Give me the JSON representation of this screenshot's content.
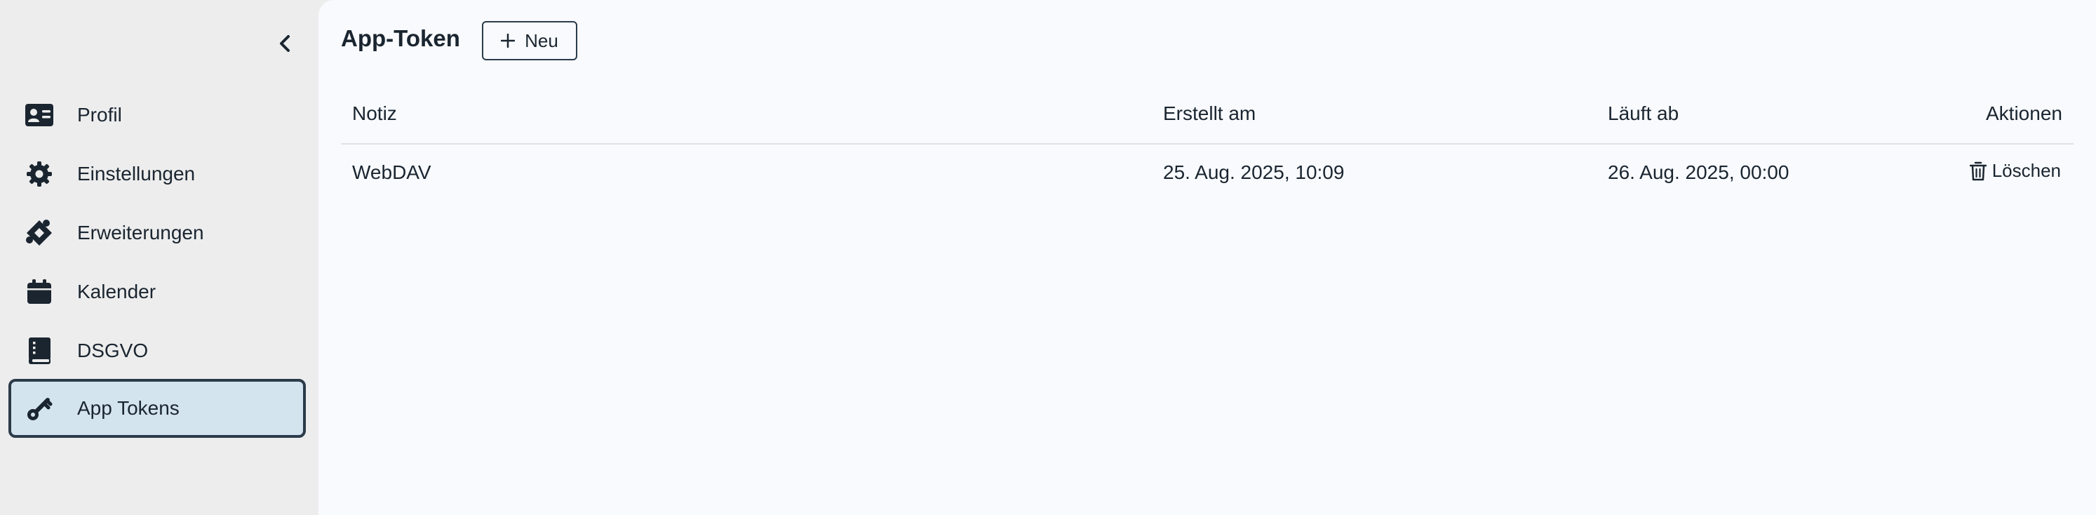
{
  "sidebar": {
    "items": [
      {
        "label": "Profil",
        "icon": "id-card-icon"
      },
      {
        "label": "Einstellungen",
        "icon": "gear-icon"
      },
      {
        "label": "Erweiterungen",
        "icon": "puzzle-icon"
      },
      {
        "label": "Kalender",
        "icon": "calendar-icon"
      },
      {
        "label": "DSGVO",
        "icon": "book-icon"
      },
      {
        "label": "App Tokens",
        "icon": "key-icon",
        "active": true
      }
    ]
  },
  "main": {
    "title": "App-Token",
    "new_button_label": "Neu",
    "table": {
      "headers": {
        "note": "Notiz",
        "created": "Erstellt am",
        "expires": "Läuft ab",
        "actions": "Aktionen"
      },
      "rows": [
        {
          "note": "WebDAV",
          "created": "25. Aug. 2025, 10:09",
          "expires": "26. Aug. 2025, 00:00",
          "action_label": "Löschen"
        }
      ]
    }
  },
  "colors": {
    "sidebar_bg": "#ededed",
    "main_bg": "#f8fafd",
    "active_bg": "#d4e4ef",
    "text": "#1a2530",
    "border": "#2b3b4a"
  }
}
